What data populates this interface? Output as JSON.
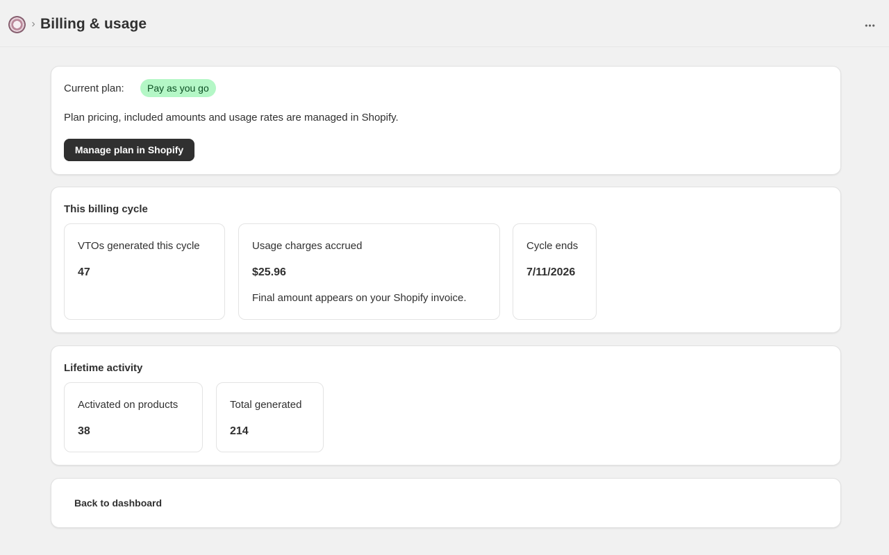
{
  "header": {
    "app_logo_icon": "app-logo-icon",
    "breadcrumb_separator": "›",
    "title": "Billing & usage",
    "more_label": "•••"
  },
  "plan_card": {
    "current_plan_label": "Current plan:",
    "plan_badge": "Pay as you go",
    "description": "Plan pricing, included amounts and usage rates are managed in Shopify.",
    "manage_button_label": "Manage plan in Shopify",
    "badge_color": "#b4f7c6",
    "button_color": "#303030"
  },
  "billing_cycle": {
    "title": "This billing cycle",
    "stats": [
      {
        "label": "VTOs generated this cycle",
        "value": "47"
      },
      {
        "label": "Usage charges accrued",
        "value": "$25.96",
        "note": "Final amount appears on your Shopify invoice."
      },
      {
        "label": "Cycle ends",
        "value": "7/11/2026"
      }
    ]
  },
  "lifetime_activity": {
    "title": "Lifetime activity",
    "stats": [
      {
        "label": "Activated on products",
        "value": "38"
      },
      {
        "label": "Total generated",
        "value": "214"
      }
    ]
  },
  "footer_card": {
    "back_label": "Back to dashboard"
  }
}
